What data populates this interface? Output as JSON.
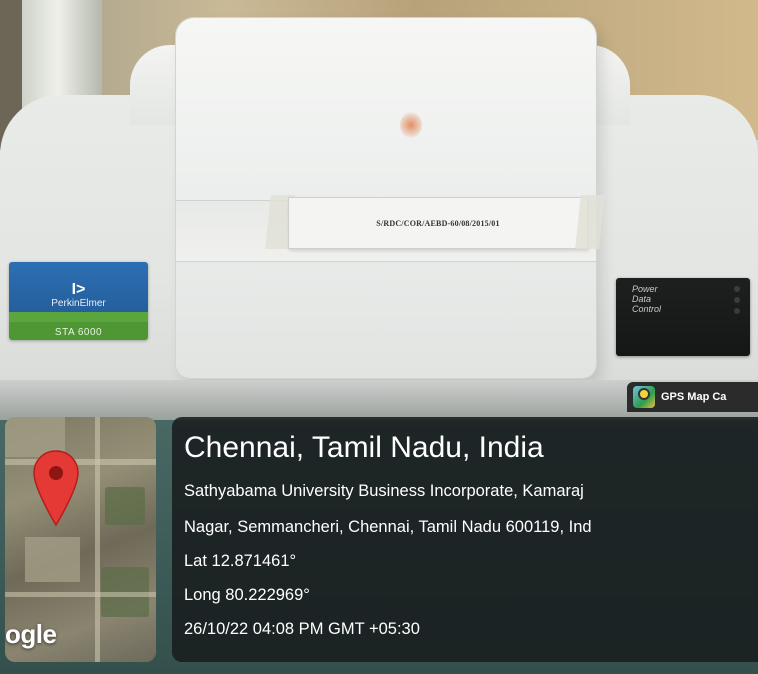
{
  "device": {
    "sticker_text": "S/RDC/COR/AEBD-60/08/2015/01",
    "badge": {
      "logo_glyph": "I>",
      "brand": "PerkinElmer",
      "model": "STA 6000"
    },
    "panel_labels": [
      "Power",
      "Data",
      "Control"
    ]
  },
  "gps_overlay": {
    "app_label": "GPS Map Ca",
    "map_watermark": "ogle",
    "location_title": "Chennai, Tamil Nadu, India",
    "address_line_1": "Sathyabama University Business Incorporate, Kamaraj",
    "address_line_2": "Nagar, Semmancheri, Chennai, Tamil Nadu 600119, Ind",
    "latitude": "Lat 12.871461°",
    "longitude": "Long 80.222969°",
    "timestamp": "26/10/22 04:08 PM GMT +05:30",
    "pin_color": "#e53935"
  }
}
